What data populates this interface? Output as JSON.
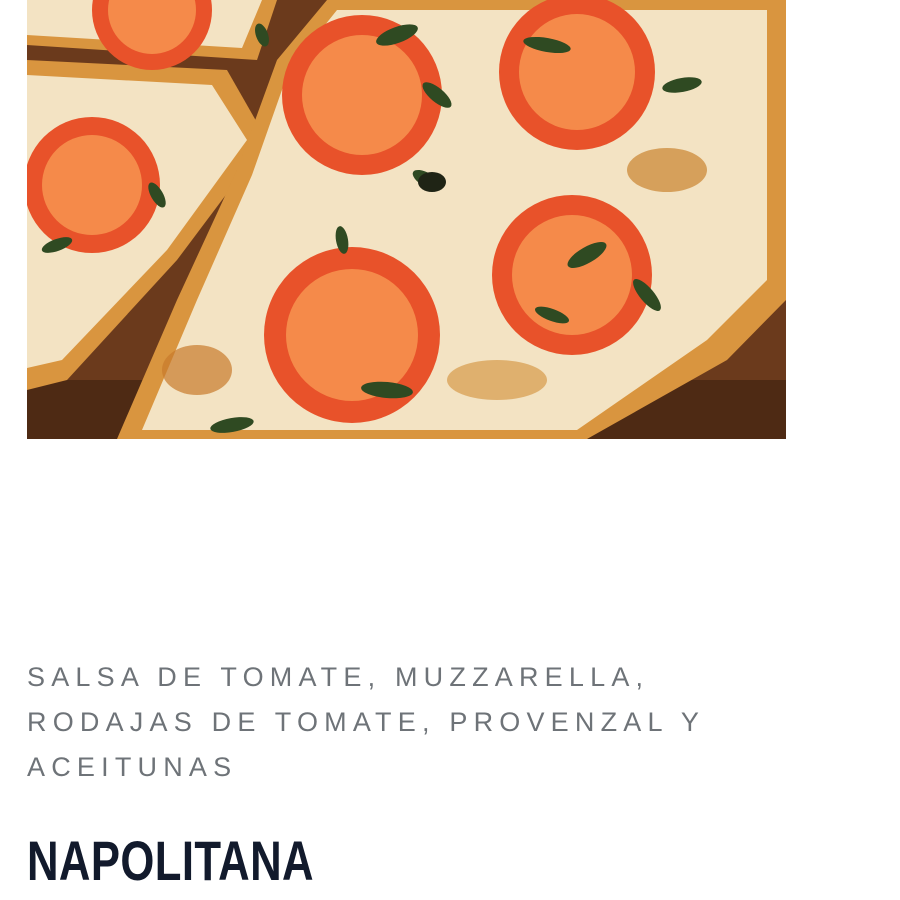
{
  "product": {
    "image": {
      "subject": "pizza-photo",
      "colors": {
        "board": "#6b3a1c",
        "crust": "#d9953f",
        "cheese": "#f3e3c3",
        "tomato": "#e8522a",
        "tomato_inner": "#f58a4a",
        "herb": "#2f4a22"
      }
    },
    "description": "SALSA DE TOMATE, MUZZARELLA, RODAJAS DE TOMATE, PROVENZAL Y ACEITUNAS",
    "name": "NAPOLITANA",
    "colors": {
      "description_text": "#6e7378",
      "name_text": "#121a2c"
    }
  }
}
